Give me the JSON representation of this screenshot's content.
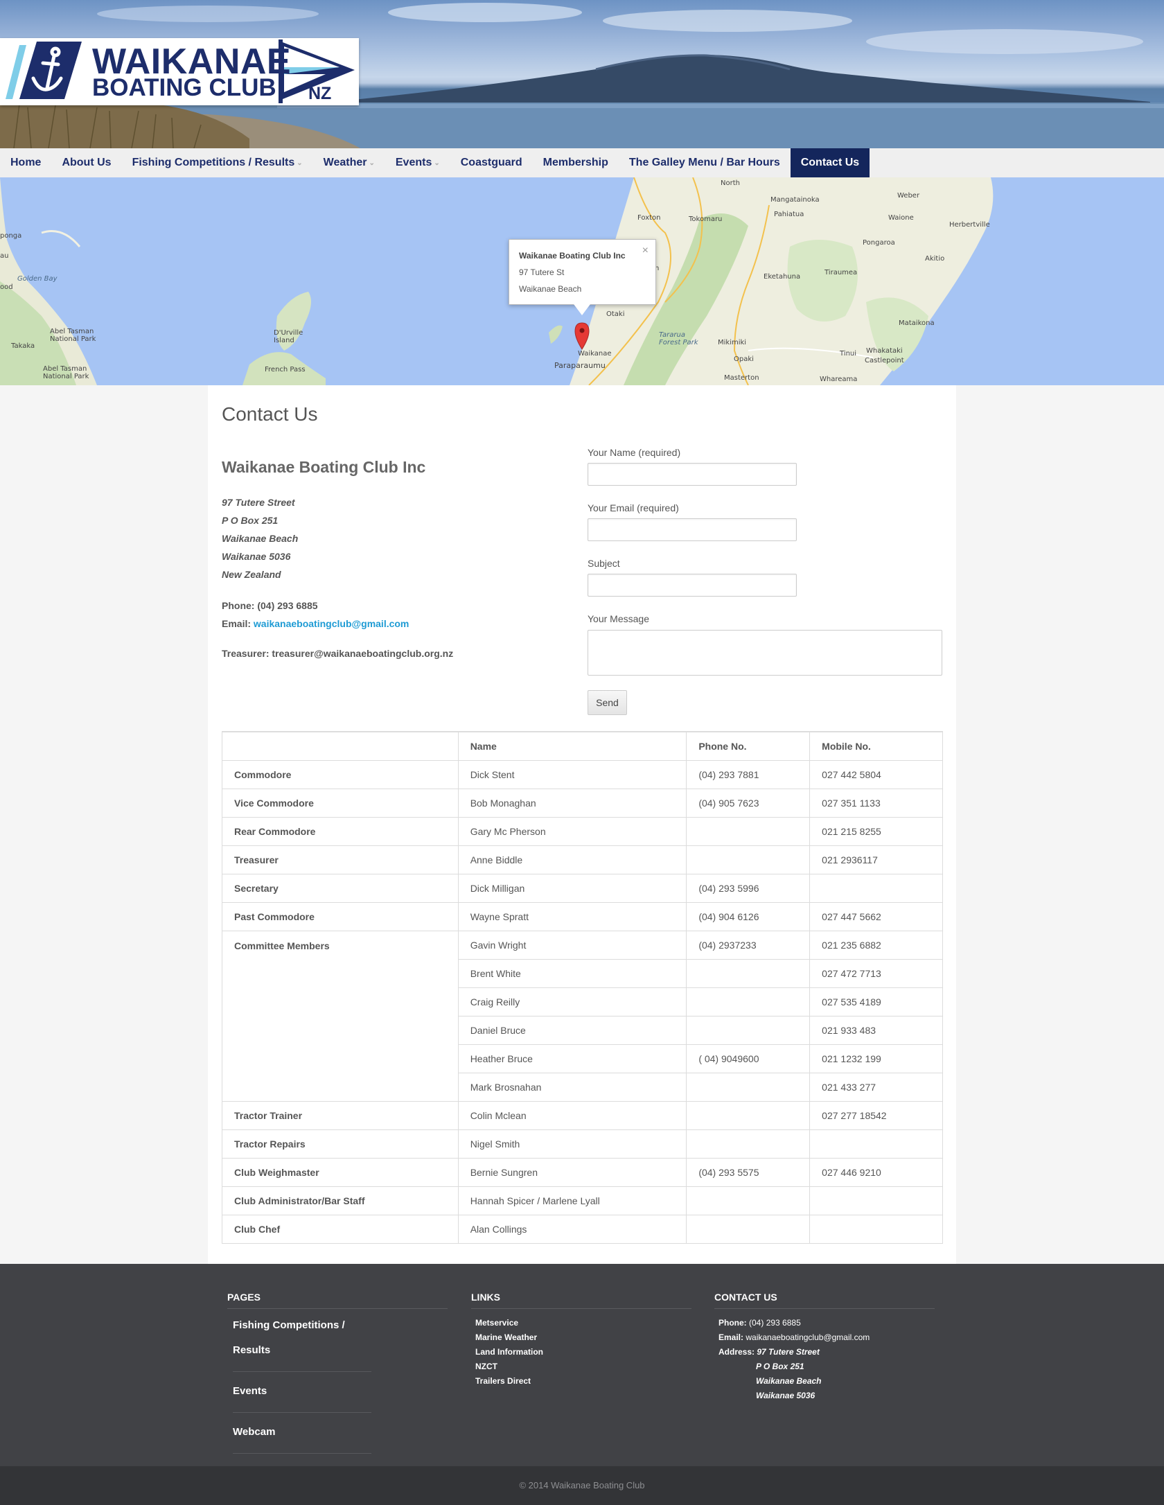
{
  "header": {
    "logo_title": "WAIKANAE",
    "logo_subtitle": "BOATING CLUB",
    "logo_flag": "NZ",
    "icons": [
      "anchor-icon",
      "pennant-flag-icon"
    ]
  },
  "nav": {
    "items": [
      {
        "label": "Home",
        "has_dropdown": false
      },
      {
        "label": "About Us",
        "has_dropdown": false
      },
      {
        "label": "Fishing Competitions / Results",
        "has_dropdown": true
      },
      {
        "label": "Weather",
        "has_dropdown": true
      },
      {
        "label": "Events",
        "has_dropdown": true
      },
      {
        "label": "Coastguard",
        "has_dropdown": false
      },
      {
        "label": "Membership",
        "has_dropdown": false
      },
      {
        "label": "The Galley Menu / Bar Hours",
        "has_dropdown": false
      },
      {
        "label": "Contact Us",
        "has_dropdown": false,
        "active": true
      }
    ],
    "active_color": "#14265c",
    "text_color": "#1d2d6b"
  },
  "map": {
    "popup": {
      "title": "Waikanae Boating Club Inc",
      "line1": "97 Tutere St",
      "line2": "Waikanae Beach",
      "close_icon": "close-icon"
    },
    "marker_icon": "map-pin-icon",
    "labels": {
      "ponga": "ponga",
      "au": "au",
      "golden_bay": "Golden Bay",
      "ood": "ood",
      "abel_tasman_np": "Abel Tasman National Park",
      "takaka": "Takaka",
      "abel_tasman_np2": "Abel Tasman National Park",
      "durville": "D'Urville Island",
      "french_pass": "French Pass",
      "foxton": "Foxton",
      "tokomaru": "Tokomaru",
      "palmerston_north": "North",
      "mangatainoka": "Mangatainoka",
      "pahiatua": "Pahiatua",
      "weber": "Weber",
      "waione": "Waione",
      "herbertville": "Herbertville",
      "pongaroa": "Pongaroa",
      "akitio": "Akitio",
      "eketahuna": "Eketahuna",
      "tiraumea": "Tiraumea",
      "otaki": "Otaki",
      "tararua": "Tararua Forest Park",
      "waikanae": "Waikanae",
      "paraparaumu": "Paraparaumu",
      "mikimiki": "Mikimiki",
      "opaki": "Opaki",
      "masterton": "Masterton",
      "mataikona": "Mataikona",
      "tinui": "Tinui",
      "whakataki": "Whakataki",
      "castlepoint": "Castlepoint",
      "whareama": "Whareama",
      "n": "n"
    }
  },
  "content": {
    "page_title": "Contact Us",
    "club_name": "Waikanae Boating Club Inc",
    "address": [
      "97 Tutere Street",
      "P O Box 251",
      "Waikanae Beach",
      "Waikanae 5036",
      "New Zealand"
    ],
    "phone_label": "Phone:",
    "phone_value": "(04) 293 6885",
    "email_label": "Email:",
    "email_value": "waikanaeboatingclub@gmail.com",
    "treasurer_label": "Treasurer:",
    "treasurer_value": "treasurer@waikanaeboatingclub.org.nz",
    "link_color": "#1e9bd4"
  },
  "form": {
    "name_label": "Your Name (required)",
    "name_value": "",
    "email_label": "Your Email (required)",
    "email_value": "",
    "subject_label": "Subject",
    "subject_value": "",
    "message_label": "Your Message",
    "message_value": "",
    "send_label": "Send"
  },
  "officers": {
    "headers": [
      "",
      "Name",
      "Phone No.",
      "Mobile No."
    ],
    "rows": [
      {
        "role": "Commodore",
        "name": "Dick Stent",
        "phone": "(04) 293 7881",
        "mobile": "027 442 5804"
      },
      {
        "role": "Vice Commodore",
        "name": "Bob Monaghan",
        "phone": "(04) 905 7623",
        "mobile": "027 351 1133"
      },
      {
        "role": "Rear Commodore",
        "name": "Gary Mc Pherson",
        "phone": "",
        "mobile": "021 215 8255"
      },
      {
        "role": "Treasurer",
        "name": "Anne Biddle",
        "phone": "",
        "mobile": "021 2936117"
      },
      {
        "role": "Secretary",
        "name": "Dick Milligan",
        "phone": "(04) 293 5996",
        "mobile": ""
      },
      {
        "role": "Past Commodore",
        "name": "Wayne Spratt",
        "phone": "(04) 904 6126",
        "mobile": "027 447  5662"
      },
      {
        "role": "Committee Members",
        "name": "Gavin Wright",
        "phone": "(04) 2937233",
        "mobile": "021 235 6882"
      },
      {
        "role": "",
        "name": "Brent White",
        "phone": "",
        "mobile": "027 472 7713"
      },
      {
        "role": "",
        "name": "Craig Reilly",
        "phone": "",
        "mobile": "027 535 4189"
      },
      {
        "role": "",
        "name": "Daniel Bruce",
        "phone": "",
        "mobile": "021 933 483"
      },
      {
        "role": "",
        "name": "Heather Bruce",
        "phone": "( 04) 9049600",
        "mobile": "021 1232 199"
      },
      {
        "role": "",
        "name": "Mark Brosnahan",
        "phone": "",
        "mobile": "021 433 277"
      },
      {
        "role": "Tractor Trainer",
        "name": "Colin Mclean",
        "phone": "",
        "mobile": "027 277 18542"
      },
      {
        "role": "Tractor Repairs",
        "name": "Nigel Smith",
        "phone": "",
        "mobile": ""
      },
      {
        "role": "Club Weighmaster",
        "name": "Bernie Sungren",
        "phone": "(04) 293 5575",
        "mobile": "027 446 9210"
      },
      {
        "role": "Club Administrator/Bar Staff",
        "name": "Hannah Spicer / Marlene Lyall",
        "phone": "",
        "mobile": ""
      },
      {
        "role": "Club Chef",
        "name": "Alan Collings",
        "phone": "",
        "mobile": ""
      }
    ]
  },
  "footer": {
    "pages_heading": "PAGES",
    "pages": [
      "Fishing Competitions / Results",
      "Events",
      "Webcam"
    ],
    "links_heading": "LINKS",
    "links": [
      "Metservice",
      "Marine Weather",
      "Land Information",
      "NZCT",
      "Trailers Direct"
    ],
    "contact_heading": "CONTACT US",
    "phone_label": "Phone:",
    "phone_value": "(04) 293 6885",
    "email_label": "Email:",
    "email_value": "waikanaeboatingclub@gmail.com",
    "address_label": "Address:",
    "address_lines": [
      "97 Tutere Street",
      "P O Box 251",
      "Waikanae Beach",
      "Waikanae 5036"
    ],
    "background": "#414246"
  },
  "copyright": "© 2014 Waikanae Boating Club"
}
